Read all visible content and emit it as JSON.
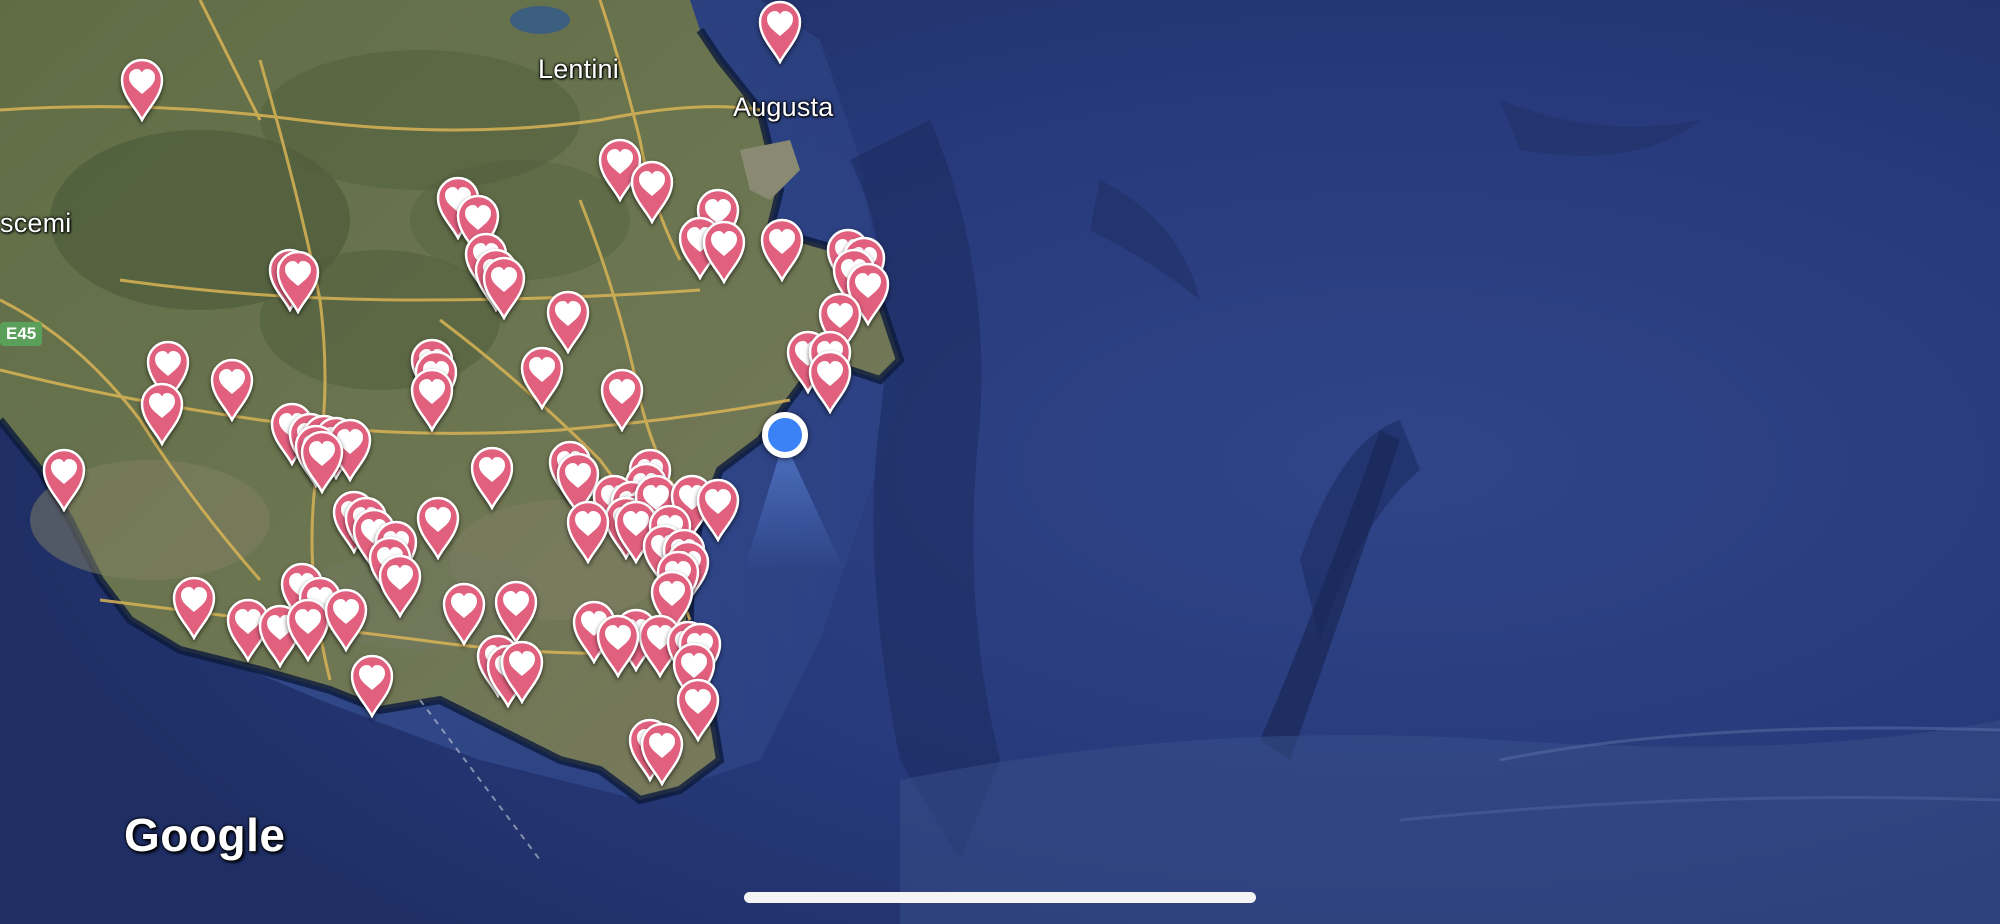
{
  "map": {
    "type": "satellite",
    "provider": "Google",
    "colors": {
      "sea_deep": "#26386f",
      "sea_shallow": "#3c5aa0",
      "land": "#5b6a44",
      "road": "#d9b456",
      "pin_fill": "#e0607e",
      "pin_stroke": "#ffffff",
      "heart": "#ffffff",
      "location_dot": "#3b82f6"
    },
    "place_labels": {
      "lentini": "Lentini",
      "augusta": "Augusta",
      "scemi": "scemi"
    },
    "road_shield": "E45",
    "logo": "Google",
    "pin_icon": "heart-pin-icon",
    "location_icon": "current-location-icon"
  }
}
